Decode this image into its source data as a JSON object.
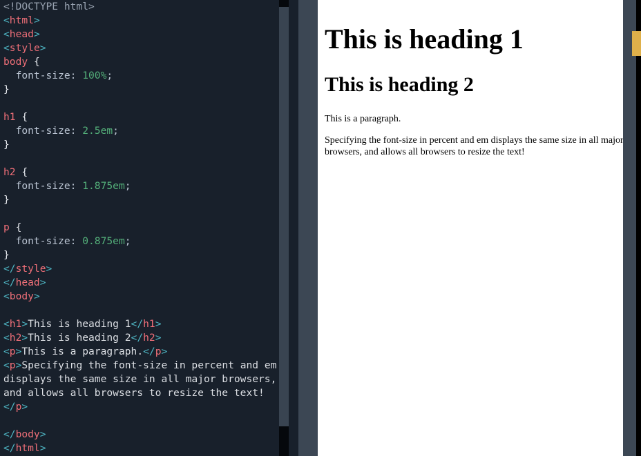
{
  "editor": {
    "language": "html",
    "lines": [
      {
        "tokens": [
          {
            "t": "doctype",
            "s": "<!DOCTYPE html>"
          }
        ]
      },
      {
        "tokens": [
          {
            "t": "punc",
            "s": "<"
          },
          {
            "t": "tag",
            "s": "html"
          },
          {
            "t": "punc",
            "s": ">"
          }
        ]
      },
      {
        "tokens": [
          {
            "t": "punc",
            "s": "<"
          },
          {
            "t": "tag",
            "s": "head"
          },
          {
            "t": "punc",
            "s": ">"
          }
        ]
      },
      {
        "tokens": [
          {
            "t": "punc",
            "s": "<"
          },
          {
            "t": "tag",
            "s": "style"
          },
          {
            "t": "punc",
            "s": ">"
          }
        ]
      },
      {
        "tokens": [
          {
            "t": "sel",
            "s": "body"
          },
          {
            "t": "brace",
            "s": " {"
          }
        ]
      },
      {
        "tokens": [
          {
            "t": "prop",
            "s": "  font-size"
          },
          {
            "t": "colon",
            "s": ": "
          },
          {
            "t": "val",
            "s": "100%"
          },
          {
            "t": "colon",
            "s": ";"
          }
        ]
      },
      {
        "tokens": [
          {
            "t": "brace",
            "s": "}"
          }
        ]
      },
      {
        "tokens": []
      },
      {
        "tokens": [
          {
            "t": "sel",
            "s": "h1"
          },
          {
            "t": "brace",
            "s": " {"
          }
        ]
      },
      {
        "tokens": [
          {
            "t": "prop",
            "s": "  font-size"
          },
          {
            "t": "colon",
            "s": ": "
          },
          {
            "t": "val",
            "s": "2.5em"
          },
          {
            "t": "colon",
            "s": ";"
          }
        ]
      },
      {
        "tokens": [
          {
            "t": "brace",
            "s": "}"
          }
        ]
      },
      {
        "tokens": []
      },
      {
        "tokens": [
          {
            "t": "sel",
            "s": "h2"
          },
          {
            "t": "brace",
            "s": " {"
          }
        ]
      },
      {
        "tokens": [
          {
            "t": "prop",
            "s": "  font-size"
          },
          {
            "t": "colon",
            "s": ": "
          },
          {
            "t": "val",
            "s": "1.875em"
          },
          {
            "t": "colon",
            "s": ";"
          }
        ]
      },
      {
        "tokens": [
          {
            "t": "brace",
            "s": "}"
          }
        ]
      },
      {
        "tokens": []
      },
      {
        "tokens": [
          {
            "t": "sel",
            "s": "p"
          },
          {
            "t": "brace",
            "s": " {"
          }
        ]
      },
      {
        "tokens": [
          {
            "t": "prop",
            "s": "  font-size"
          },
          {
            "t": "colon",
            "s": ": "
          },
          {
            "t": "val",
            "s": "0.875em"
          },
          {
            "t": "colon",
            "s": ";"
          }
        ]
      },
      {
        "tokens": [
          {
            "t": "brace",
            "s": "}"
          }
        ]
      },
      {
        "tokens": [
          {
            "t": "punc",
            "s": "</"
          },
          {
            "t": "tag",
            "s": "style"
          },
          {
            "t": "punc",
            "s": ">"
          }
        ]
      },
      {
        "tokens": [
          {
            "t": "punc",
            "s": "</"
          },
          {
            "t": "tag",
            "s": "head"
          },
          {
            "t": "punc",
            "s": ">"
          }
        ]
      },
      {
        "tokens": [
          {
            "t": "punc",
            "s": "<"
          },
          {
            "t": "tag",
            "s": "body"
          },
          {
            "t": "punc",
            "s": ">"
          }
        ]
      },
      {
        "tokens": []
      },
      {
        "tokens": [
          {
            "t": "punc",
            "s": "<"
          },
          {
            "t": "tag",
            "s": "h1"
          },
          {
            "t": "punc",
            "s": ">"
          },
          {
            "t": "text",
            "s": "This is heading 1"
          },
          {
            "t": "punc",
            "s": "</"
          },
          {
            "t": "tag",
            "s": "h1"
          },
          {
            "t": "punc",
            "s": ">"
          }
        ]
      },
      {
        "tokens": [
          {
            "t": "punc",
            "s": "<"
          },
          {
            "t": "tag",
            "s": "h2"
          },
          {
            "t": "punc",
            "s": ">"
          },
          {
            "t": "text",
            "s": "This is heading 2"
          },
          {
            "t": "punc",
            "s": "</"
          },
          {
            "t": "tag",
            "s": "h2"
          },
          {
            "t": "punc",
            "s": ">"
          }
        ]
      },
      {
        "tokens": [
          {
            "t": "punc",
            "s": "<"
          },
          {
            "t": "tag",
            "s": "p"
          },
          {
            "t": "punc",
            "s": ">"
          },
          {
            "t": "text",
            "s": "This is a paragraph."
          },
          {
            "t": "punc",
            "s": "</"
          },
          {
            "t": "tag",
            "s": "p"
          },
          {
            "t": "punc",
            "s": ">"
          }
        ]
      },
      {
        "tokens": [
          {
            "t": "punc",
            "s": "<"
          },
          {
            "t": "tag",
            "s": "p"
          },
          {
            "t": "punc",
            "s": ">"
          },
          {
            "t": "text",
            "s": "Specifying the font-size in percent and em"
          }
        ]
      },
      {
        "tokens": [
          {
            "t": "text",
            "s": "displays the same size in all major browsers,"
          }
        ]
      },
      {
        "tokens": [
          {
            "t": "text",
            "s": "and allows all browsers to resize the text!"
          }
        ]
      },
      {
        "tokens": [
          {
            "t": "punc",
            "s": "</"
          },
          {
            "t": "tag",
            "s": "p"
          },
          {
            "t": "punc",
            "s": ">"
          }
        ]
      },
      {
        "tokens": []
      },
      {
        "tokens": [
          {
            "t": "punc",
            "s": "</"
          },
          {
            "t": "tag",
            "s": "body"
          },
          {
            "t": "punc",
            "s": ">"
          }
        ]
      },
      {
        "tokens": [
          {
            "t": "punc",
            "s": "</"
          },
          {
            "t": "tag",
            "s": "html"
          },
          {
            "t": "punc",
            "s": ">"
          }
        ]
      }
    ]
  },
  "preview": {
    "heading1": "This is heading 1",
    "heading2": "This is heading 2",
    "paragraph1": "This is a paragraph.",
    "paragraph2": "Specifying the font-size in percent and em displays the same size in all major browsers, and allows all browsers to resize the text!"
  },
  "colors": {
    "editor_background": "#18202b",
    "editor_text": "#dcdfe4",
    "token_doctype": "#9aa4b2",
    "token_punctuation": "#4fb6c4",
    "token_tag": "#ef6f78",
    "token_selector": "#ef6f78",
    "token_property": "#bcc6d4",
    "token_value": "#54b07a",
    "scrollbar_track": "#3c4754",
    "editor_scrollbar_thumb": "#05080c",
    "preview_scrollbar_thumb": "#dfb04a",
    "preview_background": "#ffffff",
    "preview_text": "#000000"
  }
}
